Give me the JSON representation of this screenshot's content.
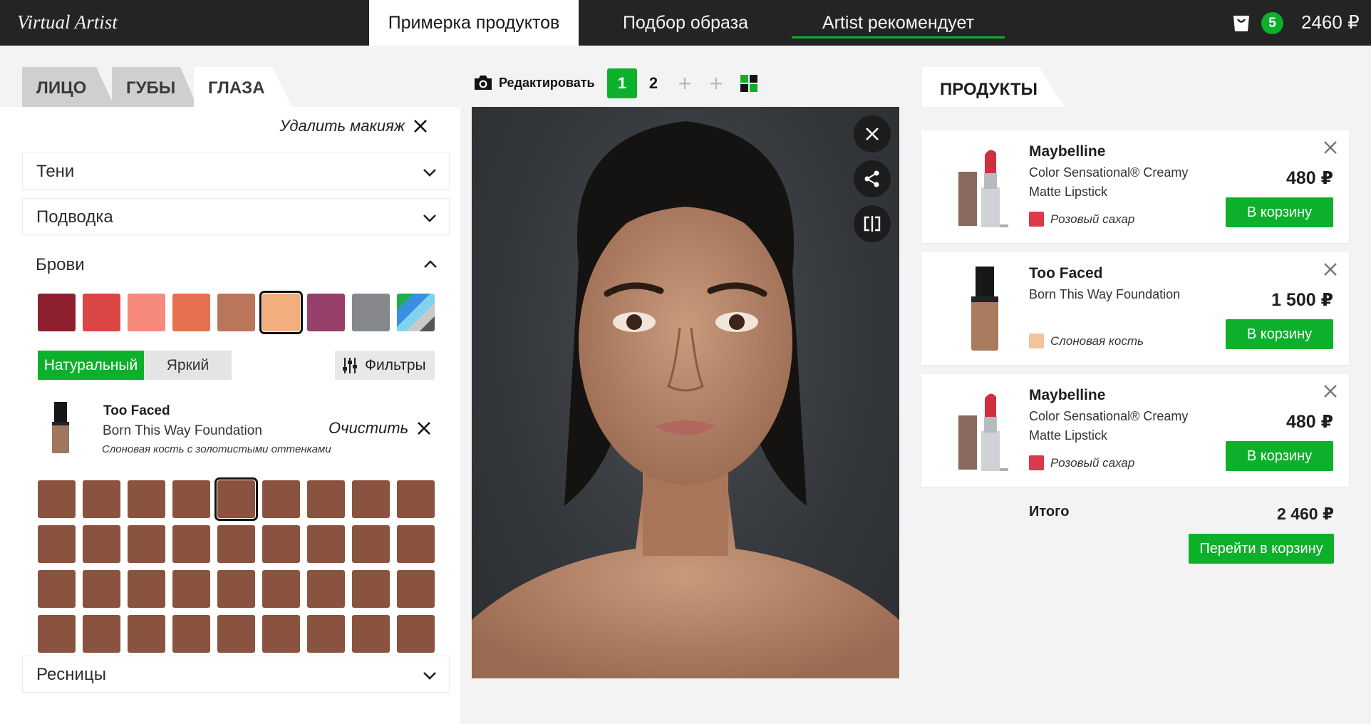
{
  "app": {
    "brand": "Virtual Artist",
    "nav_tabs": [
      {
        "label": "Примерка продуктов",
        "active": true
      },
      {
        "label": "Подбор образа",
        "active": false
      },
      {
        "label": "Artist рекомендует",
        "active": false,
        "underlined": true
      }
    ],
    "cart_count": "5",
    "cart_total": "2460 ₽",
    "accent_color": "#0db02b",
    "header_bg": "#242424"
  },
  "left": {
    "tabs": [
      {
        "label": "ЛИЦО",
        "active": false
      },
      {
        "label": "ГУБЫ",
        "active": false
      },
      {
        "label": "ГЛАЗА",
        "active": true
      }
    ],
    "remove_makeup": "Удалить макияж",
    "accordions": {
      "shadows": "Тени",
      "liner": "Подводка",
      "brows": "Брови",
      "lashes": "Ресницы"
    },
    "colors": [
      "#8e1f2f",
      "#dc4545",
      "#f7897a",
      "#e4704f",
      "#bb755b",
      "#f2af7d",
      "#96406a",
      "#85878b",
      "pattern"
    ],
    "selected_color_index": 5,
    "finish_options": [
      "Натуральный",
      "Яркий"
    ],
    "finish_active_index": 0,
    "filters_label": "Фильтры",
    "product": {
      "brand": "Too Faced",
      "name": "Born This Way Foundation",
      "shade": "Слоновая кость с золотистыми оттенками"
    },
    "clear_label": "Очистить",
    "shade_grid": {
      "rows": 4,
      "cols": 9,
      "color": "#8a5340",
      "selected_index": 4
    }
  },
  "center": {
    "edit_label": "Редактировать",
    "look_tabs": [
      "1",
      "2",
      "+",
      "+"
    ],
    "active_look_index": 0
  },
  "right": {
    "tab": "ПРОДУКТЫ",
    "items": [
      {
        "brand": "Maybelline",
        "name": "Color Sensational® Creamy Matte Lipstick",
        "shade": "Розовый сахар",
        "shade_color": "#dc3a4a",
        "price": "480 ₽",
        "button": "В корзину",
        "product_type": "lipstick"
      },
      {
        "brand": "Too Faced",
        "name": "Born This Way Foundation",
        "shade": "Слоновая кость",
        "shade_color": "#f2c39c",
        "price": "1 500 ₽",
        "button": "В корзину",
        "product_type": "foundation"
      },
      {
        "brand": "Maybelline",
        "name": "Color Sensational® Creamy Matte Lipstick",
        "shade": "Розовый сахар",
        "shade_color": "#dc3a4a",
        "price": "480 ₽",
        "button": "В корзину",
        "product_type": "lipstick"
      }
    ],
    "total_label": "Итого",
    "total_value": "2 460 ₽",
    "checkout": "Перейти в корзину"
  }
}
